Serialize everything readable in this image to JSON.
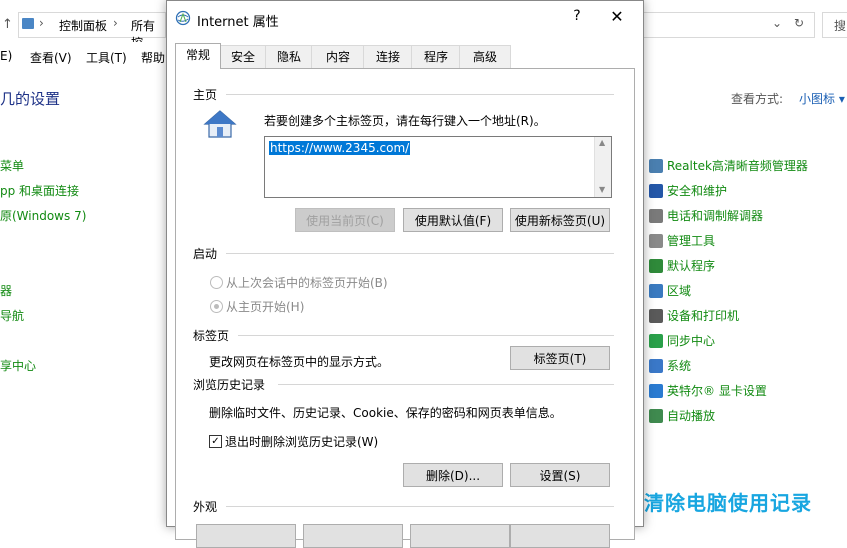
{
  "background": {
    "address_crumbs": [
      "控制面板",
      "所有控"
    ],
    "menu": [
      "E)",
      "查看(V)",
      "工具(T)",
      "帮助"
    ],
    "page_title": "几的设置",
    "left_links": [
      "菜单",
      "pp 和桌面连接",
      "原(Windows 7)",
      "器",
      "导航",
      "享中心"
    ],
    "view_label": "查看方式:",
    "view_value": "小图标",
    "right_items": [
      {
        "label": "Realtek高清晰音频管理器",
        "icon": "speaker-icon",
        "color": "#4a7fb0"
      },
      {
        "label": "安全和维护",
        "icon": "flag-icon",
        "color": "#2457a8"
      },
      {
        "label": "电话和调制解调器",
        "icon": "phone-icon",
        "color": "#7a7a7a"
      },
      {
        "label": "管理工具",
        "icon": "tools-icon",
        "color": "#8a8a8a"
      },
      {
        "label": "默认程序",
        "icon": "check-icon",
        "color": "#2f8a3a"
      },
      {
        "label": "区域",
        "icon": "globe-icon",
        "color": "#3a7ac0"
      },
      {
        "label": "设备和打印机",
        "icon": "printer-icon",
        "color": "#5a5a5a"
      },
      {
        "label": "同步中心",
        "icon": "sync-icon",
        "color": "#2aa04a"
      },
      {
        "label": "系统",
        "icon": "monitor-icon",
        "color": "#3a78c8"
      },
      {
        "label": "英特尔® 显卡设置",
        "icon": "intel-icon",
        "color": "#2b7bd1"
      },
      {
        "label": "自动播放",
        "icon": "autoplay-icon",
        "color": "#3f8a4f"
      }
    ],
    "watermark": "清除电脑使用记录"
  },
  "dialog": {
    "title": "Internet 属性",
    "help": "?",
    "close": "✕",
    "tabs": [
      "常规",
      "安全",
      "隐私",
      "内容",
      "连接",
      "程序",
      "高级"
    ],
    "home": {
      "section": "主页",
      "instruction": "若要创建多个主标签页，请在每行键入一个地址(R)。",
      "url": "https://www.2345.com/",
      "btn_current": "使用当前页(C)",
      "btn_default": "使用默认值(F)",
      "btn_newtab": "使用新标签页(U)"
    },
    "startup": {
      "section": "启动",
      "option1": "从上次会话中的标签页开始(B)",
      "option2": "从主页开始(H)",
      "selected": 2
    },
    "tabs_section": {
      "section": "标签页",
      "desc": "更改网页在标签页中的显示方式。",
      "button": "标签页(T)"
    },
    "history": {
      "section": "浏览历史记录",
      "desc": "删除临时文件、历史记录、Cookie、保存的密码和网页表单信息。",
      "checkbox": "退出时删除浏览历史记录(W)",
      "checked": true,
      "btn_delete": "删除(D)...",
      "btn_settings": "设置(S)"
    },
    "appearance": {
      "section": "外观"
    }
  }
}
